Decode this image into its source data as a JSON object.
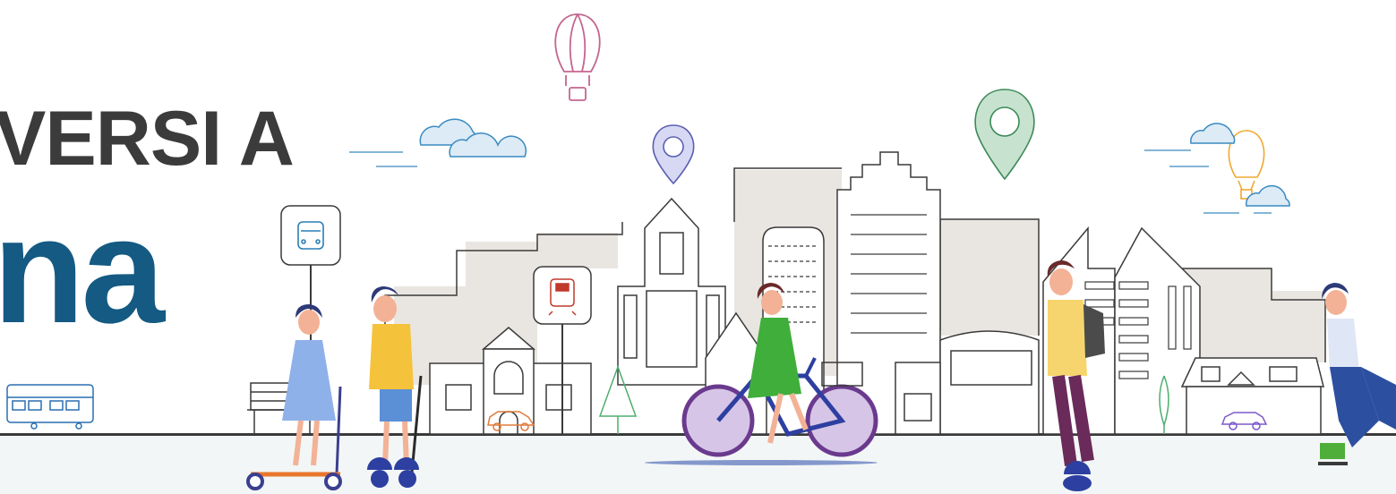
{
  "heading": {
    "line1": "VERSI A",
    "line2": "na"
  },
  "colors": {
    "title_dark": "#3b3b3b",
    "title_blue": "#145a83",
    "outline": "#3a3a3a",
    "building_fill": "#e9e6e1",
    "balloon_pink": "#c4668f",
    "balloon_orange": "#f0a830",
    "pin_purple": "#8a8fd1",
    "pin_green": "#5fa37a",
    "cloud_blue": "#9ecbe5",
    "bike_blue": "#2d3fa0",
    "dress_green": "#3fae3a",
    "shirt_yellow": "#f7c54a"
  },
  "icons": [
    "bus-icon",
    "metro-icon",
    "location-pin-icon",
    "hot-air-balloon-icon",
    "cloud-icon",
    "car-icon",
    "tree-icon",
    "bench-icon",
    "tram-icon"
  ]
}
